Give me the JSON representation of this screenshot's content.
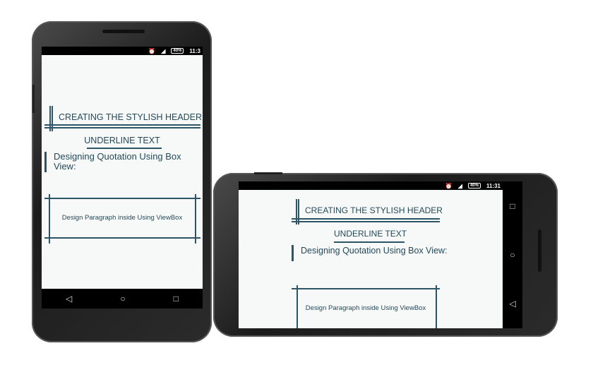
{
  "status_bar": {
    "time_portrait": "11:3",
    "time_landscape": "11:31",
    "battery": "40%",
    "alarm_icon": "alarm-icon",
    "signal_icon": "signal-icon"
  },
  "content": {
    "header": "CREATING THE STYLISH HEADER",
    "underline": "UNDERLINE TEXT",
    "quotation": "Designing Quotation Using Box View:",
    "paragraph": "Design Paragraph inside Using ViewBox"
  },
  "navbar": {
    "back": "◁",
    "home": "○",
    "recents": "□"
  },
  "colors": {
    "accent": "#2d5566",
    "text": "#244a5a"
  }
}
